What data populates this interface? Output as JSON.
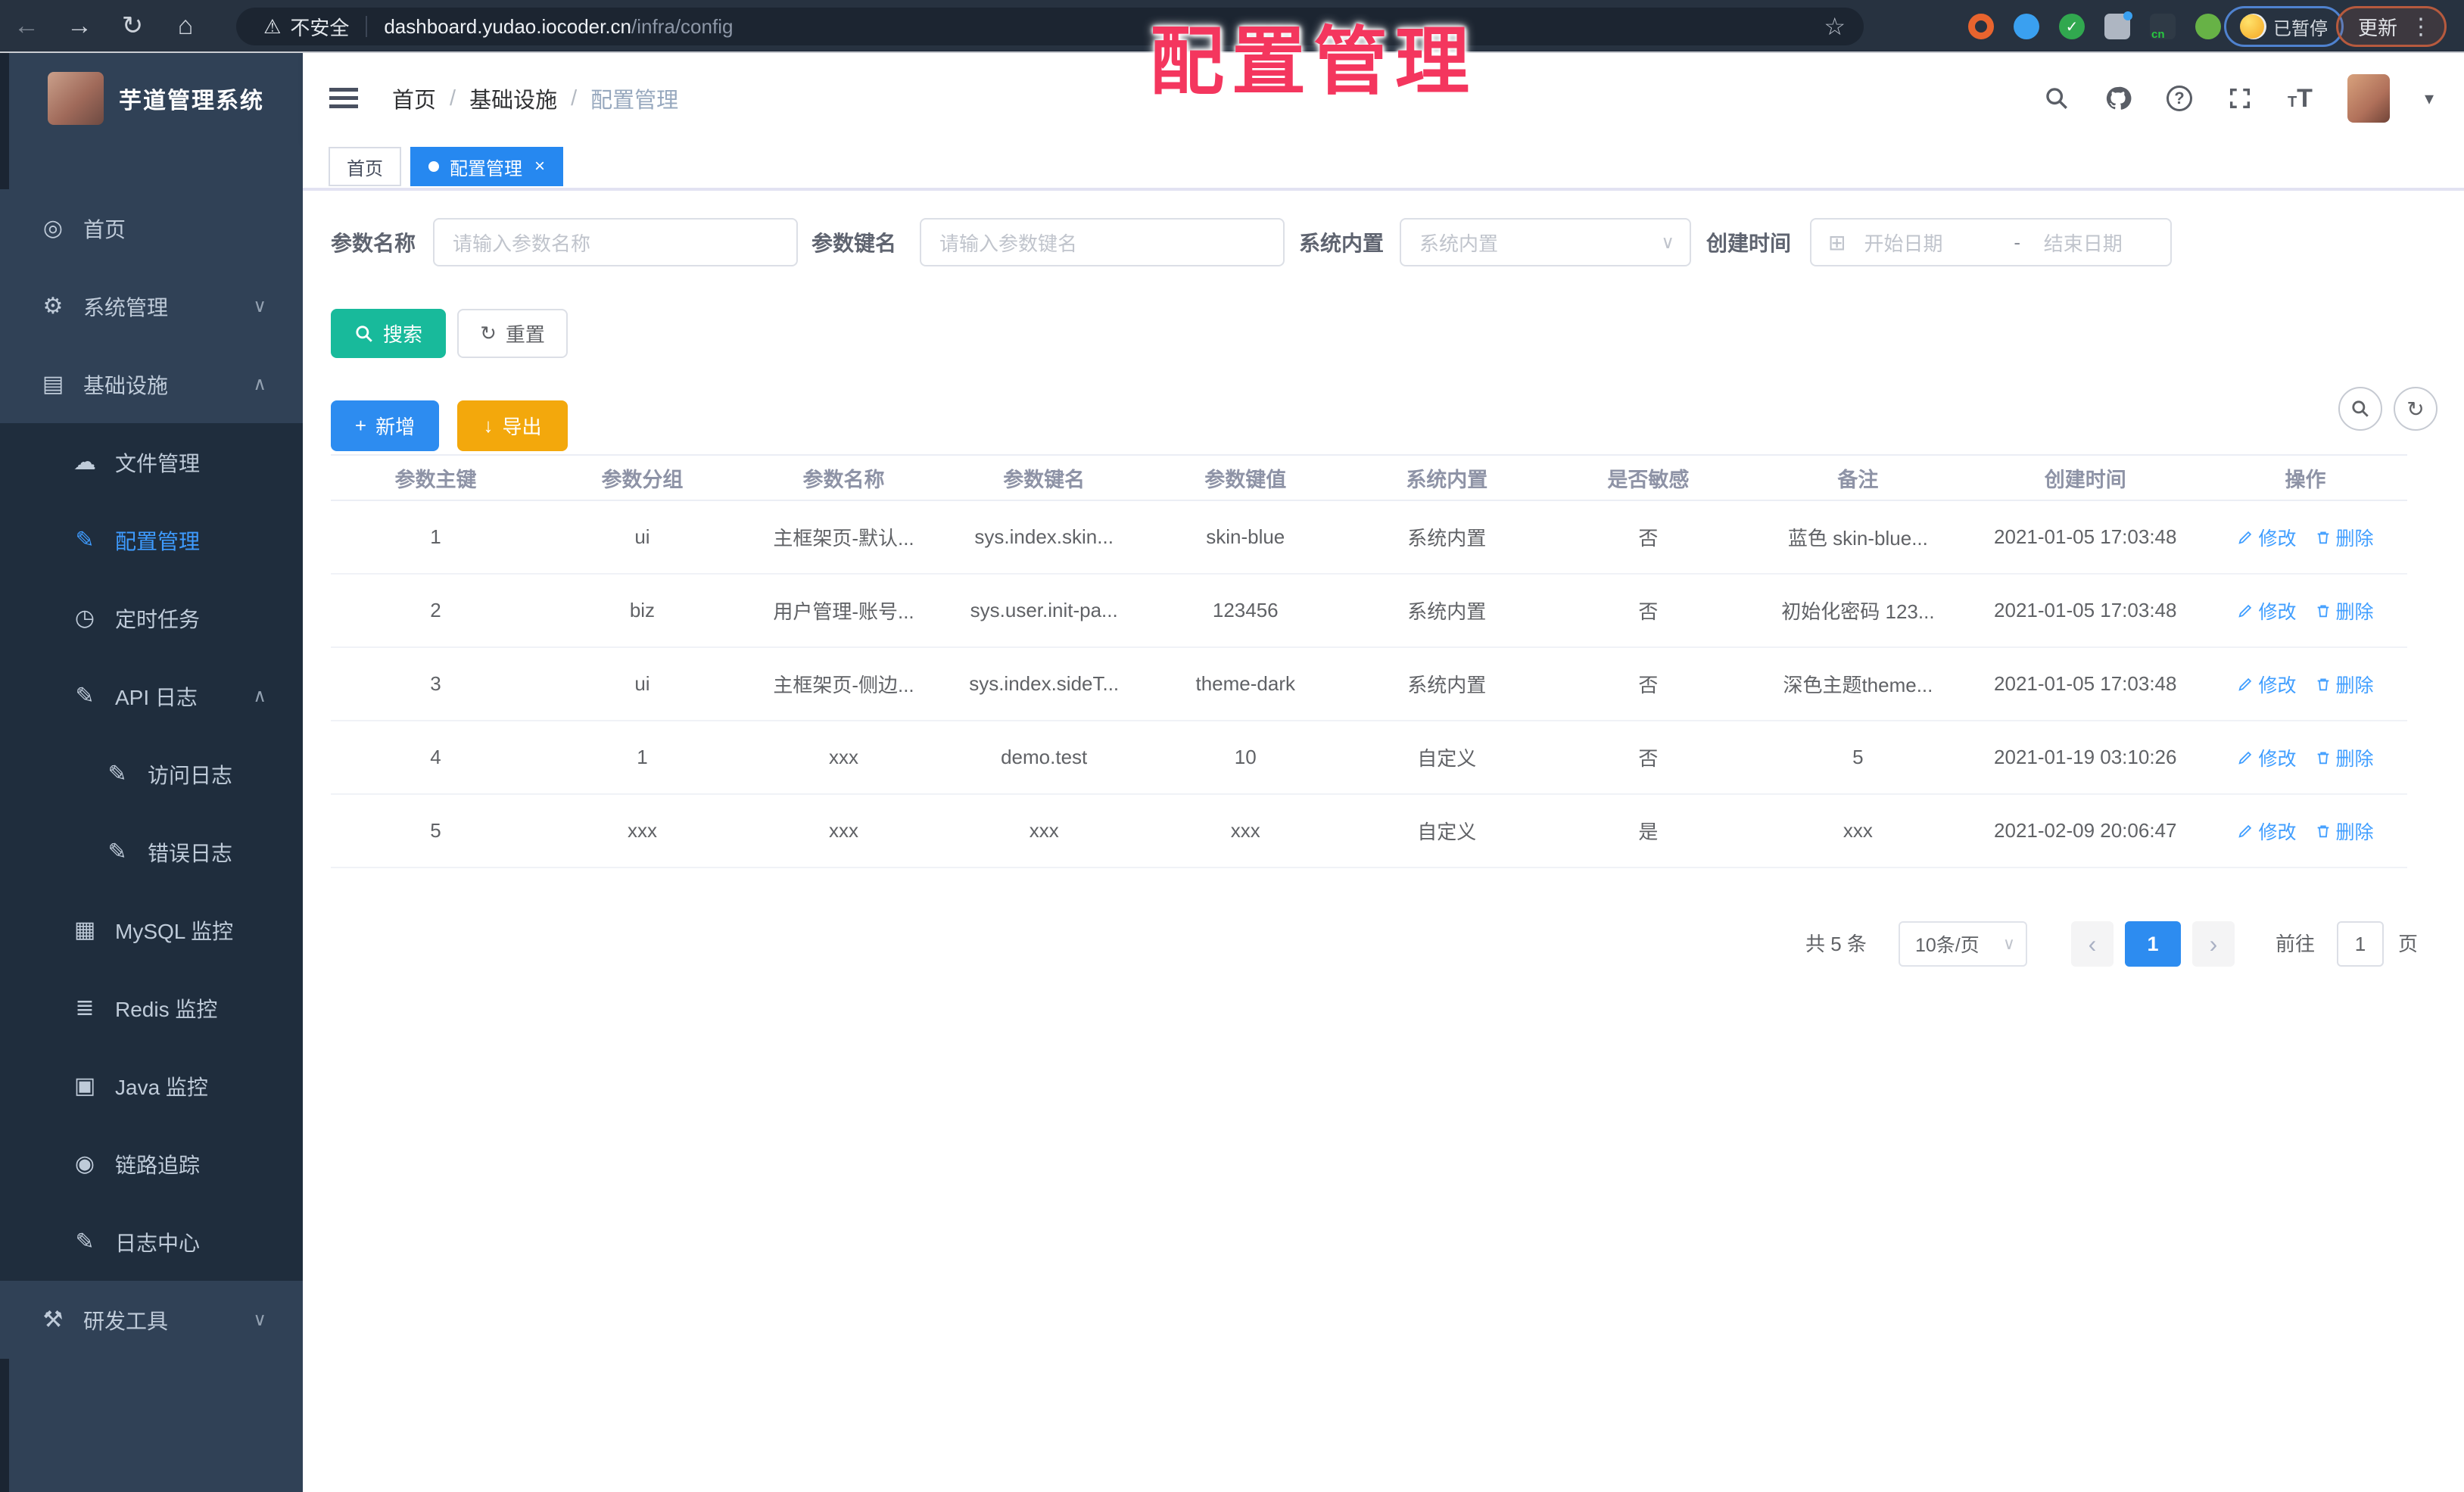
{
  "browser": {
    "security_label": "不安全",
    "url_host": "dashboard.yudao.iocoder.cn",
    "url_path": "/infra/config",
    "paused_label": "已暂停",
    "update_label": "更新",
    "extensions": [
      {
        "name": "ext-orange-ring",
        "color": "#e8642e",
        "style": "ring"
      },
      {
        "name": "ext-blue-pin",
        "color": "#3aa0f0",
        "style": "circle"
      },
      {
        "name": "ext-green-check",
        "color": "#31a84f",
        "style": "circle",
        "glyph": "✓"
      },
      {
        "name": "ext-grid",
        "color": "#aeb6c2",
        "style": "square",
        "dot": true
      },
      {
        "name": "ext-cn-badge",
        "color": "#2f3a46",
        "style": "square",
        "badge": "cn"
      },
      {
        "name": "ext-leaf",
        "color": "#67b246",
        "style": "circle"
      },
      {
        "name": "ext-puzzle",
        "color": "#e9ecef",
        "style": "circle"
      }
    ]
  },
  "overlay": {
    "title": "配置管理"
  },
  "sidebar": {
    "app_title": "芋道管理系统",
    "items": [
      {
        "label": "首页",
        "icon": "dashboard-icon",
        "glyph": "◎",
        "level": 0
      },
      {
        "label": "系统管理",
        "icon": "gear-icon",
        "glyph": "⚙",
        "level": 0,
        "chevron": "down"
      },
      {
        "label": "基础设施",
        "icon": "infra-monitor-icon",
        "glyph": "▤",
        "level": 0,
        "chevron": "up"
      },
      {
        "label": "文件管理",
        "icon": "cloud-icon",
        "glyph": "☁",
        "level": 1
      },
      {
        "label": "配置管理",
        "icon": "edit-square-icon",
        "glyph": "✎",
        "level": 1,
        "active": true
      },
      {
        "label": "定时任务",
        "icon": "timer-icon",
        "glyph": "◷",
        "level": 1
      },
      {
        "label": "API 日志",
        "icon": "log-icon",
        "glyph": "✎",
        "level": 1,
        "chevron": "up"
      },
      {
        "label": "访问日志",
        "icon": "access-log-icon",
        "glyph": "✎",
        "level": 2
      },
      {
        "label": "错误日志",
        "icon": "error-log-icon",
        "glyph": "✎",
        "level": 2
      },
      {
        "label": "MySQL 监控",
        "icon": "mysql-icon",
        "glyph": "▦",
        "level": 1
      },
      {
        "label": "Redis 监控",
        "icon": "redis-icon",
        "glyph": "≣",
        "level": 1
      },
      {
        "label": "Java 监控",
        "icon": "java-icon",
        "glyph": "▣",
        "level": 1
      },
      {
        "label": "链路追踪",
        "icon": "trace-eye-icon",
        "glyph": "◉",
        "level": 1
      },
      {
        "label": "日志中心",
        "icon": "log-center-icon",
        "glyph": "✎",
        "level": 1
      },
      {
        "label": "研发工具",
        "icon": "tools-icon",
        "glyph": "⚒",
        "level": 0,
        "chevron": "down"
      }
    ]
  },
  "navbar": {
    "breadcrumb": [
      {
        "label": "首页"
      },
      {
        "label": "基础设施"
      },
      {
        "label": "配置管理",
        "current": true
      }
    ],
    "breadcrumb_separator": "/"
  },
  "tabs": [
    {
      "label": "首页",
      "active": false
    },
    {
      "label": "配置管理",
      "active": true,
      "closable": true
    }
  ],
  "filters": {
    "name_label": "参数名称",
    "name_placeholder": "请输入参数名称",
    "key_label": "参数键名",
    "key_placeholder": "请输入参数键名",
    "type_label": "系统内置",
    "type_placeholder": "系统内置",
    "date_label": "创建时间",
    "date_start": "开始日期",
    "date_separator": "-",
    "date_end": "结束日期",
    "search_label": "搜索",
    "reset_label": "重置",
    "add_label": "新增",
    "export_label": "导出"
  },
  "table": {
    "columns": [
      "参数主键",
      "参数分组",
      "参数名称",
      "参数键名",
      "参数键值",
      "系统内置",
      "是否敏感",
      "备注",
      "创建时间",
      "操作"
    ],
    "rows": [
      [
        "1",
        "ui",
        "主框架页-默认...",
        "sys.index.skin...",
        "skin-blue",
        "系统内置",
        "否",
        "蓝色 skin-blue...",
        "2021-01-05 17:03:48"
      ],
      [
        "2",
        "biz",
        "用户管理-账号...",
        "sys.user.init-pa...",
        "123456",
        "系统内置",
        "否",
        "初始化密码 123...",
        "2021-01-05 17:03:48"
      ],
      [
        "3",
        "ui",
        "主框架页-侧边...",
        "sys.index.sideT...",
        "theme-dark",
        "系统内置",
        "否",
        "深色主题theme...",
        "2021-01-05 17:03:48"
      ],
      [
        "4",
        "1",
        "xxx",
        "demo.test",
        "10",
        "自定义",
        "否",
        "5",
        "2021-01-19 03:10:26"
      ],
      [
        "5",
        "xxx",
        "xxx",
        "xxx",
        "xxx",
        "自定义",
        "是",
        "xxx",
        "2021-02-09 20:06:47"
      ]
    ],
    "edit_label": "修改",
    "delete_label": "删除"
  },
  "pagination": {
    "total_label": "共 5 条",
    "page_size": "10条/页",
    "current_page": "1",
    "goto_label": "前往",
    "goto_value": "1",
    "page_unit": "页"
  },
  "colors": {
    "accent_blue": "#2d8cf0",
    "link_blue": "#409eff",
    "active_menu_blue": "#3e9bff",
    "search_teal": "#18ba9b",
    "export_amber": "#f3a80c",
    "annotation_red": "#f4365e",
    "sidebar_bg": "#304156",
    "submenu_bg": "#1f2d3d"
  }
}
